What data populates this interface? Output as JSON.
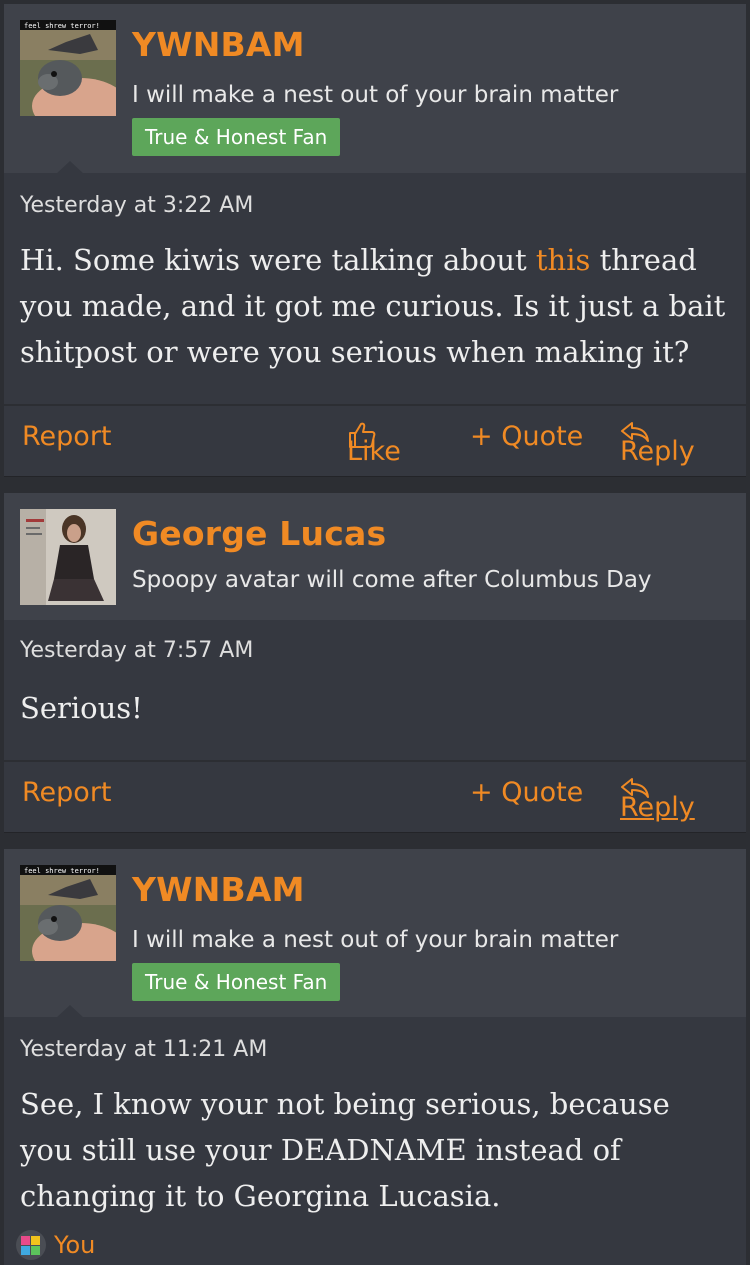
{
  "posts": [
    {
      "avatar_caption": "feel shrew terror!",
      "username": "YWNBAM",
      "user_title": "I will make a nest out of your brain matter",
      "banner": "True & Honest Fan",
      "timestamp": "Yesterday at 3:22 AM",
      "body_part1": "Hi. Some kiwis were talking about ",
      "body_link": "this",
      "body_part2": " thread you made, and it got me curious. Is it just a bait shitpost or were you serious when making it?",
      "actions": {
        "report": "Report",
        "like": "Like",
        "quote": "+ Quote",
        "reply": "Reply"
      }
    },
    {
      "username": "George Lucas",
      "user_title": "Spoopy avatar will come after Columbus Day",
      "timestamp": "Yesterday at 7:57 AM",
      "body": "Serious!",
      "actions": {
        "report": "Report",
        "quote": "+ Quote",
        "reply": "Reply"
      }
    },
    {
      "avatar_caption": "feel shrew terror!",
      "username": "YWNBAM",
      "user_title": "I will make a nest out of your brain matter",
      "banner": "True & Honest Fan",
      "timestamp": "Yesterday at 11:21 AM",
      "body": "See, I know your not being serious, because you still use your DEADNAME instead of changing it to Georgina Lucasia.",
      "reaction_user": "You"
    }
  ],
  "colors": {
    "accent": "#f08a24",
    "banner": "#5da65a",
    "panel": "#353840",
    "header": "#3f424a"
  }
}
